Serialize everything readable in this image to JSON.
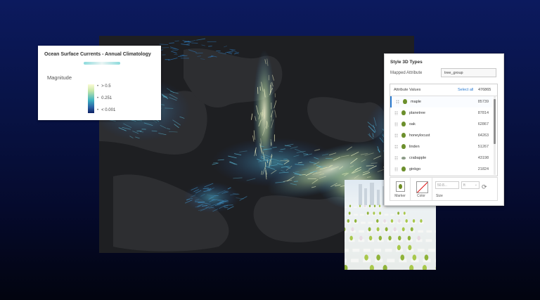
{
  "legend": {
    "title": "Ocean Surface Currents - Annual Climatology",
    "field_label": "Magnitude",
    "ticks": [
      "> 0.5",
      "0.251",
      "< 0.001"
    ]
  },
  "style_panel": {
    "title": "Style 3D Types",
    "mapped_attribute_label": "Mapped Attribute",
    "mapped_attribute_value": "tree_group",
    "list_header": {
      "label": "Attribute Values",
      "select_all": "Select all",
      "total": "476865"
    },
    "rows": [
      {
        "name": "maple",
        "count": "85739",
        "icon": "tree-icon"
      },
      {
        "name": "planetree",
        "count": "87814",
        "icon": "tree-icon"
      },
      {
        "name": "oak",
        "count": "62867",
        "icon": "tree-icon"
      },
      {
        "name": "honeylocust",
        "count": "64263",
        "icon": "tree-icon"
      },
      {
        "name": "linden",
        "count": "51267",
        "icon": "tree-icon"
      },
      {
        "name": "crabapple",
        "count": "43198",
        "icon": "shrub-icon"
      },
      {
        "name": "ginkgo",
        "count": "21824",
        "icon": "tree-icon"
      }
    ],
    "bottom": {
      "marker_label": "Marker",
      "color_label": "Color",
      "size_label": "Size",
      "size_value": "50.8...",
      "size_unit": "ft"
    }
  },
  "colors": {
    "background_top": "#0c1a5e",
    "background_bottom": "#02040f",
    "accent": "#2b7bd0",
    "current_low": "#1a3f8c",
    "current_mid": "#3fb3c1",
    "current_high": "#fbfbd6",
    "tree_green": "#6c8f2c"
  }
}
